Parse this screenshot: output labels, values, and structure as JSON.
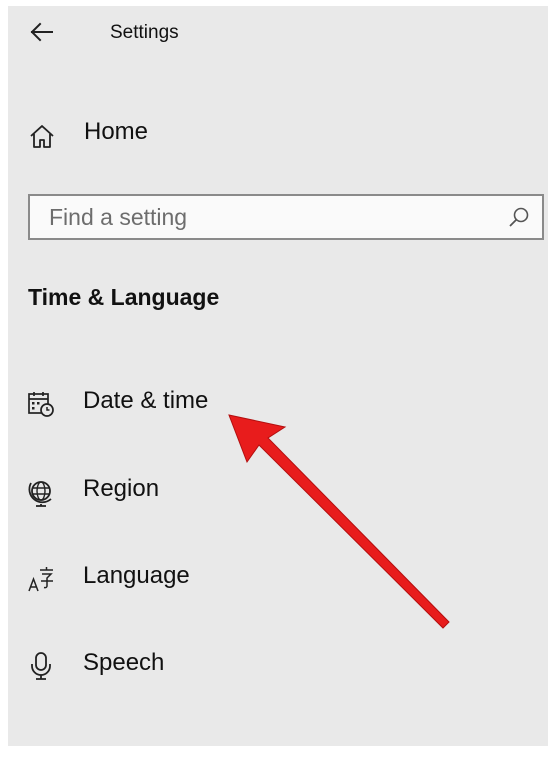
{
  "header": {
    "title": "Settings",
    "back_icon": "arrow-left-icon"
  },
  "nav": {
    "home": {
      "label": "Home",
      "icon": "home-icon"
    }
  },
  "search": {
    "placeholder": "Find a setting",
    "value": "",
    "icon": "search-icon"
  },
  "section": {
    "heading": "Time & Language"
  },
  "items": [
    {
      "label": "Date & time",
      "icon": "calendar-clock-icon"
    },
    {
      "label": "Region",
      "icon": "globe-icon"
    },
    {
      "label": "Language",
      "icon": "language-icon"
    },
    {
      "label": "Speech",
      "icon": "microphone-icon"
    }
  ],
  "annotation": {
    "arrow_color": "#e81c1c"
  },
  "colors": {
    "panel_background": "#e9e9e9",
    "search_border": "#8a8a8a"
  }
}
